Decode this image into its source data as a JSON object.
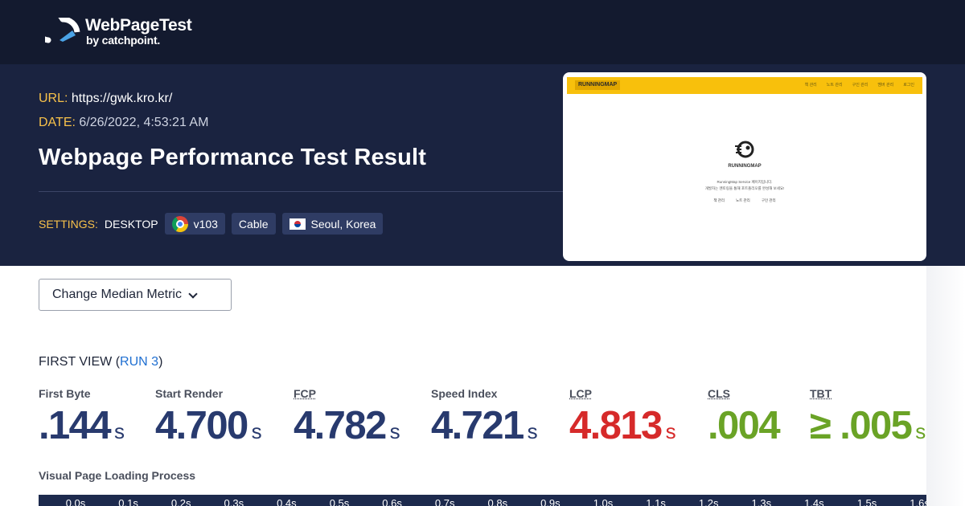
{
  "header": {
    "brand_title": "WebPageTest",
    "brand_subtitle": "by catchpoint."
  },
  "test": {
    "url_key": "URL:",
    "url_value": "https://gwk.kro.kr/",
    "date_key": "DATE:",
    "date_value": "6/26/2022, 4:53:21 AM",
    "title": "Webpage Performance Test Result",
    "settings_key": "SETTINGS:",
    "device": "DESKTOP",
    "browser_version": "v103",
    "connection": "Cable",
    "location": "Seoul, Korea"
  },
  "thumbnail": {
    "brand": "RUNNINGMAP",
    "nav": [
      "책 관리",
      "노트 관리",
      "구인 관리",
      "멤버 관리",
      "로그인"
    ],
    "logo_text": "RUNNINGMAP",
    "desc_line1": "RunningMap Service 페이지입니다.",
    "desc_line2": "개발자는 멘토링을 통해 포트폴리오를 완성해 보세요!",
    "links": [
      "책 관리",
      "노트 관리",
      "구인 관리"
    ]
  },
  "controls": {
    "median_metric_label": "Change Median Metric"
  },
  "first_view": {
    "label": "FIRST VIEW (",
    "run": "RUN 3",
    "close": ")"
  },
  "metrics": [
    {
      "name": "First Byte",
      "value": ".144",
      "unit": "s",
      "status": "navy"
    },
    {
      "name": "Start Render",
      "value": "4.700",
      "unit": "s",
      "status": "navy"
    },
    {
      "name": "FCP",
      "value": "4.782",
      "unit": "s",
      "status": "navy"
    },
    {
      "name": "Speed Index",
      "value": "4.721",
      "unit": "s",
      "status": "navy"
    },
    {
      "name": "LCP",
      "value": "4.813",
      "unit": "s",
      "status": "red"
    },
    {
      "name": "CLS",
      "value": ".004",
      "unit": "",
      "status": "green"
    },
    {
      "name": "TBT",
      "value": "≥ .005",
      "unit": "s",
      "status": "green"
    }
  ],
  "visual_progress": {
    "title": "Visual Page Loading Process",
    "ticks": [
      "0.0s",
      "0.1s",
      "0.2s",
      "0.3s",
      "0.4s",
      "0.5s",
      "0.6s",
      "0.7s",
      "0.8s",
      "0.9s",
      "1.0s",
      "1.1s",
      "1.2s",
      "1.3s",
      "1.4s",
      "1.5s",
      "1.6s"
    ]
  },
  "colors": {
    "header_bg": "#131a2f",
    "hero_bg": "#1a2340",
    "accent_yellow": "#f7c14a",
    "metric_navy": "#283a6e",
    "metric_red": "#d62a2a",
    "metric_green": "#6aa326"
  }
}
